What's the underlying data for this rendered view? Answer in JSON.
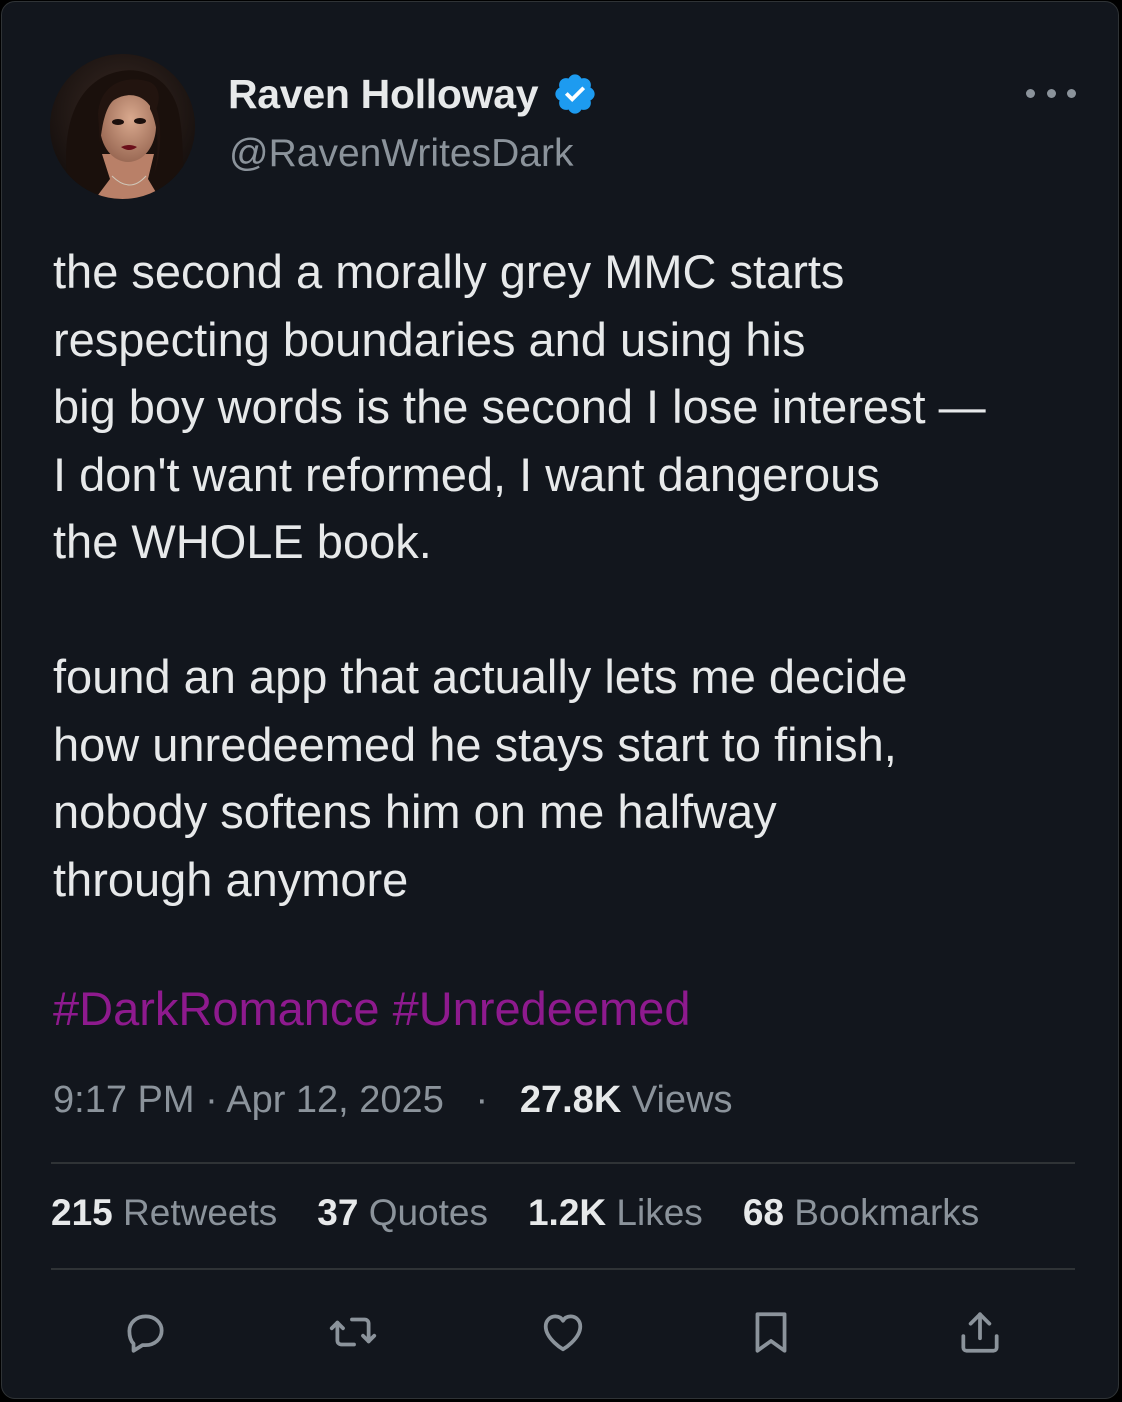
{
  "author": {
    "display_name": "Raven Holloway",
    "handle": "@RavenWritesDark",
    "verified": true
  },
  "tweet": {
    "lines": [
      "the second a morally grey MMC starts",
      "respecting boundaries and using his",
      "big boy words is the second I lose interest —",
      "I don't want reformed, I want dangerous",
      "the WHOLE book.",
      "",
      "found an app that actually lets me decide",
      "how unredeemed he stays start to finish,",
      "nobody softens him on me halfway",
      "through anymore"
    ],
    "hashtags": [
      "#DarkRomance",
      "#Unredeemed"
    ]
  },
  "meta": {
    "time": "9:17 PM",
    "separator": "·",
    "date": "Apr 12, 2025",
    "views_count": "27.8K",
    "views_label": "Views"
  },
  "stats": [
    {
      "count": "215",
      "label": "Retweets"
    },
    {
      "count": "37",
      "label": "Quotes"
    },
    {
      "count": "1.2K",
      "label": "Likes"
    },
    {
      "count": "68",
      "label": "Bookmarks"
    }
  ],
  "actions": [
    "reply-icon",
    "retweet-icon",
    "like-icon",
    "bookmark-icon",
    "share-icon"
  ],
  "colors": {
    "background": "#12161d",
    "text": "#e7e9ea",
    "secondary_text": "#8b939b",
    "hashtag": "#8e1a8e",
    "verified_badge": "#1d9bf0",
    "divider": "#2f3336"
  }
}
